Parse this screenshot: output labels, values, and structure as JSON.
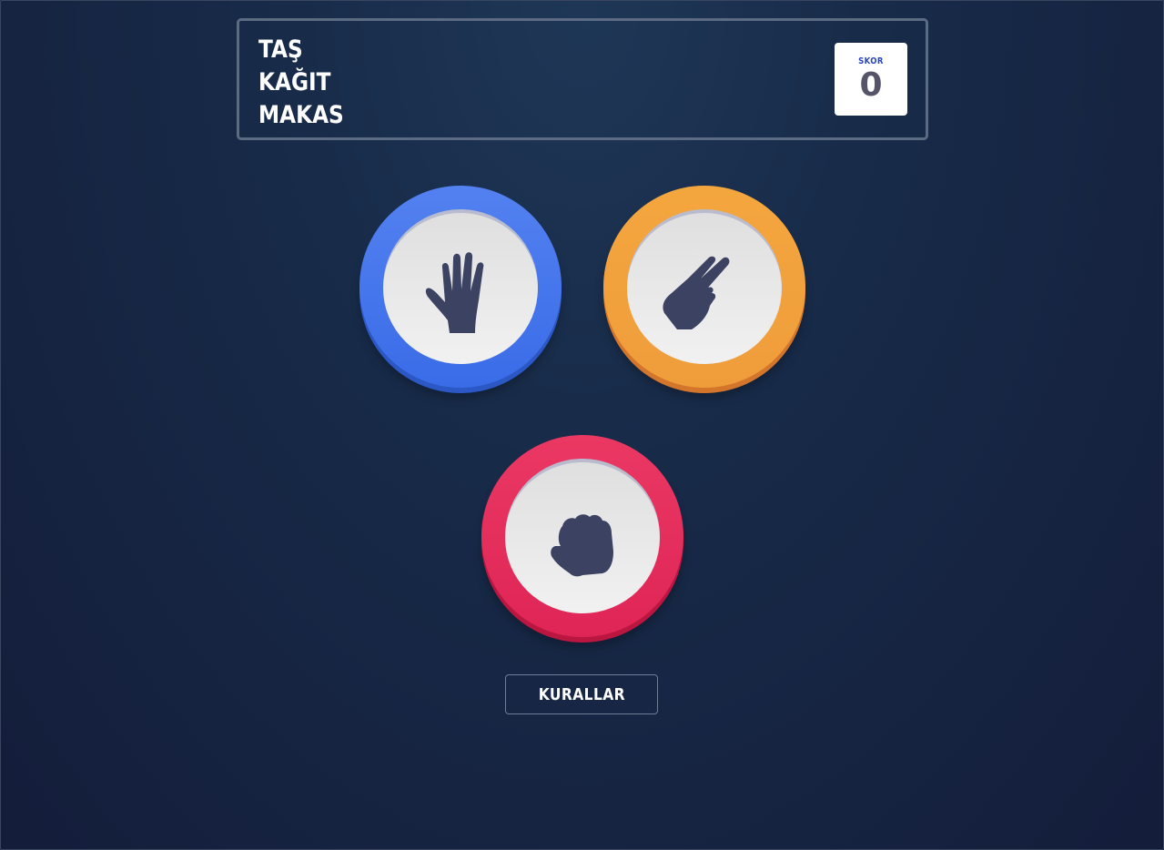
{
  "header": {
    "title_lines": [
      "TAŞ",
      "KAĞIT",
      "MAKAS"
    ]
  },
  "score": {
    "label": "SKOR",
    "value": "0"
  },
  "choices": [
    {
      "id": "paper",
      "icon": "hand-paper-icon",
      "color": "#4a77ec"
    },
    {
      "id": "scissors",
      "icon": "hand-scissors-icon",
      "color": "#f2a23d"
    },
    {
      "id": "rock",
      "icon": "hand-rock-icon",
      "color": "#e42e5c"
    }
  ],
  "rules_button": {
    "label": "KURALLAR"
  },
  "colors": {
    "background": "#172a48",
    "icon": "#3b4262",
    "score_label": "#2a46c0",
    "score_value": "#565468"
  }
}
